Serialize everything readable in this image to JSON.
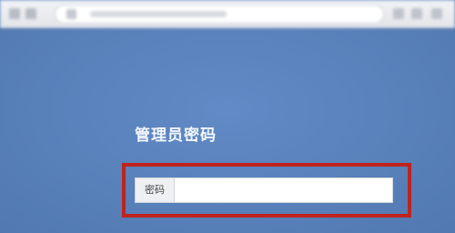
{
  "browser": {
    "address_text": "",
    "buttons": [
      "back-icon",
      "forward-icon",
      "reload-icon"
    ],
    "tools": [
      "star-icon",
      "download-icon",
      "menu-icon"
    ]
  },
  "login": {
    "title": "管理员密码",
    "password_label": "密码",
    "password_value": "",
    "password_placeholder": ""
  },
  "colors": {
    "background": "#5b86c4",
    "highlight": "#c0221e",
    "title": "#f4f7fc"
  }
}
